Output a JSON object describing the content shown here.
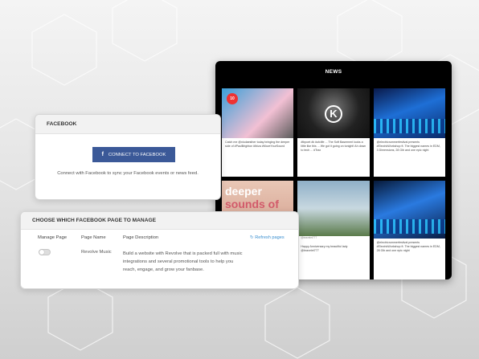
{
  "news": {
    "title": "NEWS",
    "tiles": [
      {
        "badge": "10",
        "caption": "Catch me @nicdaesther today bringing the deeper side of #PaulBrighton #Ibiza #MoveYourSound",
        "meta": ""
      },
      {
        "caption": "#tbpoet #k #ufclife ... The Soft Basement looks a little like this ... We got it going on tonight! Ah down to tech ... #Trax",
        "meta": ""
      },
      {
        "caption": "@electricrummerfestival presents #ElectricWorkshop ft. The biggest names in EDM, 3 Dimensions, 28 Gib and one epic night",
        "meta": ""
      },
      {
        "caption": "",
        "meta": "",
        "title1": "deeper",
        "title2": "sounds of"
      },
      {
        "caption": "Happy Anniversary my beautiful lady @bravelet777",
        "meta": "@bravelet777"
      },
      {
        "caption": "@electricrummerfestival presents #ElectricWorkshop ft. The biggest names in EDM, 28 Gib and one epic night",
        "meta": ""
      }
    ]
  },
  "facebook": {
    "header": "FACEBOOK",
    "connect_label": "CONNECT TO FACEBOOK",
    "note": "Connect with Facebook to sync your Facebook events or news feed."
  },
  "choose_page": {
    "header": "CHOOSE WHICH FACEBOOK PAGE TO MANAGE",
    "col_manage": "Manage Page",
    "col_name": "Page Name",
    "col_desc": "Page Description",
    "refresh_label": "Refresh pages",
    "row": {
      "name": "Revolve Music",
      "description": "Build a website with Revolve that is packed full with music integrations and several promotional tools to help you reach, engage, and grow your fanbase."
    }
  },
  "colors": {
    "facebook_blue": "#3b5998",
    "link_blue": "#3a8fd0"
  }
}
